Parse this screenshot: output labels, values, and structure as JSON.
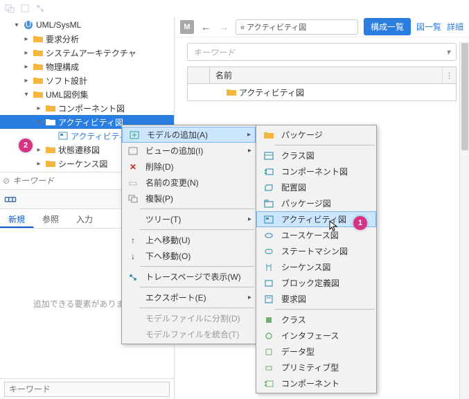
{
  "tree": {
    "root": "UML/SysML",
    "items": [
      "要求分析",
      "システムアーキテクチャ",
      "物理構成",
      "ソフト設計"
    ],
    "uml_examples": "UML図例集",
    "component": "コンポーネント図",
    "activity_folder": "アクティビティ図",
    "activity_diag": "アクティビティ図",
    "state": "状態遷移図",
    "sequence": "シーケンス図"
  },
  "keyword_placeholder": "キーワード",
  "palette_tabs": {
    "new": "新規",
    "ref": "参照",
    "input": "入力"
  },
  "palette_empty": "追加できる要素がありません",
  "right": {
    "m": "M",
    "breadcrumb": "«  アクティビティ図",
    "btn_config": "構成一覧",
    "link_zu": "図一覧",
    "link_detail": "詳細",
    "search_placeholder": "キーワード",
    "col_name": "名前",
    "row1": "アクティビティ図"
  },
  "ctx1": {
    "add_model": "モデルの追加(A)",
    "add_view": "ビューの追加(I)",
    "delete": "削除(D)",
    "rename": "名前の変更(N)",
    "duplicate": "複製(P)",
    "tree": "ツリー(T)",
    "move_up": "上へ移動(U)",
    "move_down": "下へ移動(O)",
    "trace": "トレースページで表示(W)",
    "export": "エクスポート(E)",
    "split": "モデルファイルに分割(D)",
    "merge": "モデルファイルを統合(T)"
  },
  "ctx2": {
    "package": "パッケージ",
    "class": "クラス図",
    "component": "コンポーネント図",
    "deployment": "配置図",
    "package_diag": "パッケージ図",
    "activity": "アクティビティ図",
    "usecase": "ユースケース図",
    "statemachine": "ステートマシン図",
    "sequence": "シーケンス図",
    "block": "ブロック定義図",
    "requirement": "要求図",
    "class_el": "クラス",
    "interface": "インタフェース",
    "datatype": "データ型",
    "primitive": "プリミティブ型",
    "component_el": "コンポーネント"
  },
  "markers": {
    "m1": "1",
    "m2": "2"
  }
}
